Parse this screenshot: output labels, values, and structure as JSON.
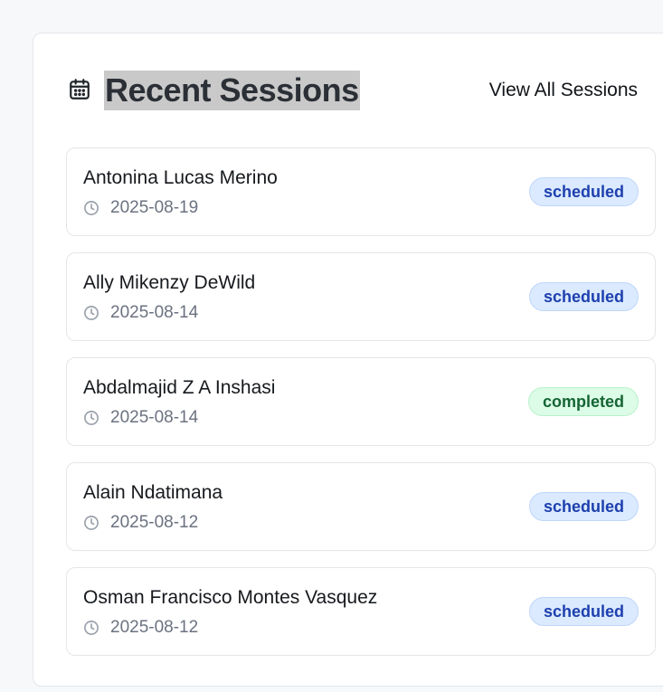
{
  "header": {
    "title": "Recent Sessions",
    "view_all_label": "View All Sessions",
    "icon": "calendar-icon"
  },
  "sessions": [
    {
      "name": "Antonina Lucas Merino",
      "date": "2025-08-19",
      "status": "scheduled"
    },
    {
      "name": "Ally Mikenzy DeWild",
      "date": "2025-08-14",
      "status": "scheduled"
    },
    {
      "name": "Abdalmajid Z A Inshasi",
      "date": "2025-08-14",
      "status": "completed"
    },
    {
      "name": "Alain Ndatimana",
      "date": "2025-08-12",
      "status": "scheduled"
    },
    {
      "name": "Osman Francisco Montes Vasquez",
      "date": "2025-08-12",
      "status": "scheduled"
    }
  ],
  "colors": {
    "scheduled_bg": "#dbeafe",
    "scheduled_text": "#1e40af",
    "completed_bg": "#dcfce7",
    "completed_text": "#166534"
  }
}
